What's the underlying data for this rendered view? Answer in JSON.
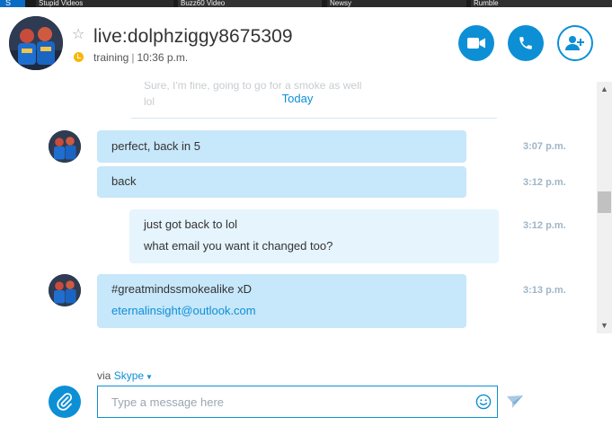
{
  "thumbnails": [
    "Stupid Videos",
    "Buzz60 Video",
    "Newsy",
    "Rumble"
  ],
  "contact": {
    "name": "live:dolphziggy8675309",
    "mood": "training",
    "separator": "|",
    "local_time": "10:36 p.m."
  },
  "actions": {
    "video_icon": "video-camera-icon",
    "call_icon": "phone-icon",
    "add_icon": "add-person-icon"
  },
  "conversation": {
    "faded_line_1": "Sure, I'm fine, going to go for a smoke as well",
    "faded_line_2": "lol",
    "day_divider": "Today",
    "messages": [
      {
        "text": "perfect, back in 5",
        "time": "3:07 p.m."
      },
      {
        "text": "back",
        "time": "3:12 p.m."
      },
      {
        "line1": "just got back to lol",
        "line2": "what email you want it changed too?",
        "time": "3:12 p.m."
      },
      {
        "line1": "#greatmindssmokealike xD",
        "line2": "eternalinsight@outlook.com",
        "time": "3:13 p.m."
      }
    ]
  },
  "composer": {
    "via_label": "via",
    "via_service": "Skype",
    "placeholder": "Type a message here"
  },
  "colors": {
    "accent": "#0d8fd6",
    "incoming_bubble": "#c7e7fa",
    "outgoing_bubble": "#e6f4fd",
    "status_away": "#f8b700"
  }
}
